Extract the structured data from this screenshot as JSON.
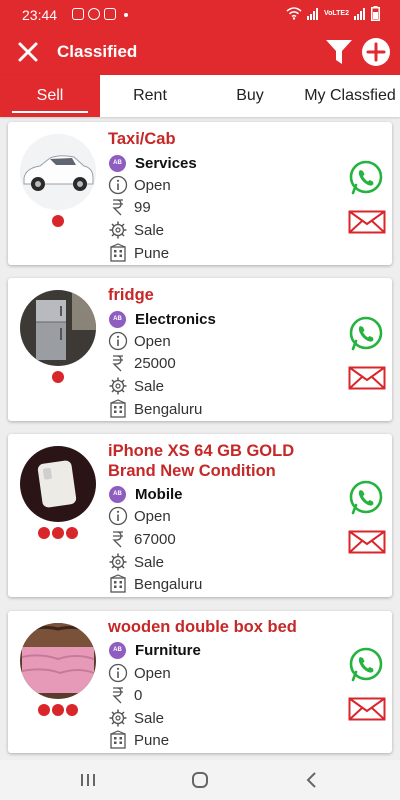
{
  "status": {
    "time": "23:44",
    "network": "VoLTE2"
  },
  "header": {
    "title": "Classified"
  },
  "tabs": [
    {
      "label": "Sell",
      "active": true
    },
    {
      "label": "Rent",
      "active": false
    },
    {
      "label": "Buy",
      "active": false
    },
    {
      "label": "My Classfied",
      "active": false
    }
  ],
  "listings": [
    {
      "title": "Taxi/Cab",
      "badge": "AB",
      "category": "Services",
      "status": "Open",
      "price": "99",
      "type": "Sale",
      "location": "Pune",
      "image_count": 1,
      "image": "white sedan car"
    },
    {
      "title": "fridge",
      "badge": "AB",
      "category": "Electronics",
      "status": "Open",
      "price": "25000",
      "type": "Sale",
      "location": "Bengaluru",
      "image_count": 1,
      "image": "grey refrigerator"
    },
    {
      "title": "iPhone XS 64 GB GOLD Brand New Condition",
      "badge": "AB",
      "category": "Mobile",
      "status": "Open",
      "price": "67000",
      "type": "Sale",
      "location": "Bengaluru",
      "image_count": 3,
      "image": "white iphone on dark cloth"
    },
    {
      "title": "wooden double box bed",
      "badge": "AB",
      "category": "Furniture",
      "status": "Open",
      "price": "0",
      "type": "Sale",
      "location": "Pune",
      "image_count": 3,
      "image": "pink bed with wooden headboard"
    }
  ],
  "colors": {
    "primary": "#e02a2d",
    "title_red": "#c62828",
    "whatsapp": "#25b33f",
    "badge_purple": "#8e5dbf"
  }
}
